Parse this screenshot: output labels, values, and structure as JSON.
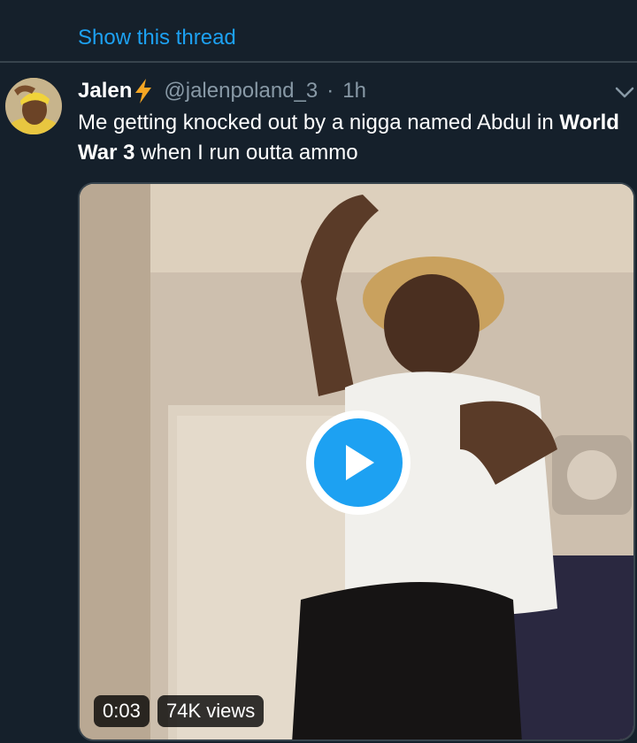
{
  "thread": {
    "show_thread_label": "Show this thread"
  },
  "tweet": {
    "display_name": "Jalen",
    "handle": "@jalenpoland_3",
    "separator": "·",
    "time": "1h",
    "text_part1": "Me getting knocked out by a nigga named Abdul in ",
    "text_bold": "World War 3",
    "text_part2": " when I run outta ammo"
  },
  "media": {
    "duration": "0:03",
    "views": "74K views"
  },
  "colors": {
    "background": "#15202b",
    "accent": "#1da1f2",
    "secondary_text": "#8899a6",
    "bolt": "#f5a623"
  },
  "icons": [
    "lightning-bolt-icon",
    "chevron-down-icon",
    "play-icon"
  ]
}
